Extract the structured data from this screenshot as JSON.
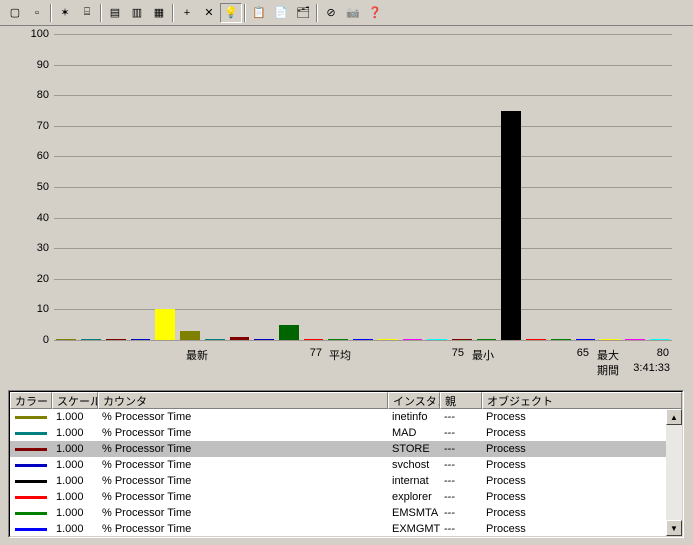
{
  "toolbar": {
    "buttons": [
      {
        "name": "new-counter-set-icon",
        "glyph": "▢"
      },
      {
        "name": "clear-display-icon",
        "glyph": "▫"
      },
      {
        "name": "view-current-icon",
        "glyph": "✶"
      },
      {
        "name": "view-log-icon",
        "glyph": "⌸"
      },
      {
        "name": "chart-icon",
        "glyph": "▤"
      },
      {
        "name": "histogram-icon",
        "glyph": "▥"
      },
      {
        "name": "report-icon",
        "glyph": "▦"
      },
      {
        "name": "add-icon",
        "glyph": "+"
      },
      {
        "name": "delete-icon",
        "glyph": "✕"
      },
      {
        "name": "highlight-icon",
        "glyph": "💡",
        "active": true
      },
      {
        "name": "copy-icon",
        "glyph": "📋"
      },
      {
        "name": "paste-icon",
        "glyph": "📄"
      },
      {
        "name": "properties-icon",
        "glyph": "🗂"
      },
      {
        "name": "freeze-icon",
        "glyph": "⊘"
      },
      {
        "name": "update-icon",
        "glyph": "📷",
        "disabled": true
      },
      {
        "name": "help-icon",
        "glyph": "❓"
      }
    ],
    "separators_after": [
      1,
      3,
      6,
      9,
      12
    ]
  },
  "stats": {
    "last_label": "最新",
    "last_value": "77",
    "avg_label": "平均",
    "avg_value": "75",
    "min_label": "最小",
    "min_value": "65",
    "max_label": "最大",
    "max_value": "80",
    "duration_label": "期間",
    "duration_value": "3:41:33"
  },
  "legend": {
    "headers": {
      "color": "カラー",
      "scale": "スケール",
      "counter": "カウンタ",
      "instance": "インスタン...",
      "parent": "親",
      "object": "オブジェクト"
    },
    "rows": [
      {
        "color": "#808000",
        "scale": "1.000",
        "counter": "% Processor Time",
        "instance": "inetinfo",
        "parent": "---",
        "object": "Process"
      },
      {
        "color": "#008080",
        "scale": "1.000",
        "counter": "% Processor Time",
        "instance": "MAD",
        "parent": "---",
        "object": "Process"
      },
      {
        "color": "#800000",
        "scale": "1.000",
        "counter": "% Processor Time",
        "instance": "STORE",
        "parent": "---",
        "object": "Process",
        "selected": true
      },
      {
        "color": "#0000c0",
        "scale": "1.000",
        "counter": "% Processor Time",
        "instance": "svchost",
        "parent": "---",
        "object": "Process"
      },
      {
        "color": "#000000",
        "scale": "1.000",
        "counter": "% Processor Time",
        "instance": "internat",
        "parent": "---",
        "object": "Process"
      },
      {
        "color": "#ff0000",
        "scale": "1.000",
        "counter": "% Processor Time",
        "instance": "explorer",
        "parent": "---",
        "object": "Process"
      },
      {
        "color": "#008000",
        "scale": "1.000",
        "counter": "% Processor Time",
        "instance": "EMSMTA",
        "parent": "---",
        "object": "Process"
      },
      {
        "color": "#0000ff",
        "scale": "1.000",
        "counter": "% Processor Time",
        "instance": "EXMGMT",
        "parent": "---",
        "object": "Process"
      }
    ]
  },
  "chart_data": {
    "type": "bar",
    "ylim": [
      0,
      100
    ],
    "yticks": [
      0,
      10,
      20,
      30,
      40,
      50,
      60,
      70,
      80,
      90,
      100
    ],
    "bars": [
      {
        "color": "#808000",
        "value": 0
      },
      {
        "color": "#008080",
        "value": 0
      },
      {
        "color": "#800000",
        "value": 0
      },
      {
        "color": "#0000c0",
        "value": 0
      },
      {
        "color": "#ffff00",
        "value": 10
      },
      {
        "color": "#808000",
        "value": 3
      },
      {
        "color": "#008080",
        "value": 0
      },
      {
        "color": "#800000",
        "value": 1
      },
      {
        "color": "#0000c0",
        "value": 0
      },
      {
        "color": "#006400",
        "value": 5
      },
      {
        "color": "#ff0000",
        "value": 0
      },
      {
        "color": "#008000",
        "value": 0
      },
      {
        "color": "#0000ff",
        "value": 0
      },
      {
        "color": "#ffff00",
        "value": 0
      },
      {
        "color": "#ff00ff",
        "value": 0
      },
      {
        "color": "#00ffff",
        "value": 0
      },
      {
        "color": "#800000",
        "value": 0
      },
      {
        "color": "#008000",
        "value": 0
      },
      {
        "color": "#000000",
        "value": 75
      },
      {
        "color": "#ff0000",
        "value": 0
      },
      {
        "color": "#008000",
        "value": 0
      },
      {
        "color": "#0000ff",
        "value": 0
      },
      {
        "color": "#ffff00",
        "value": 0
      },
      {
        "color": "#ff00ff",
        "value": 0
      },
      {
        "color": "#00ffff",
        "value": 0
      }
    ]
  }
}
